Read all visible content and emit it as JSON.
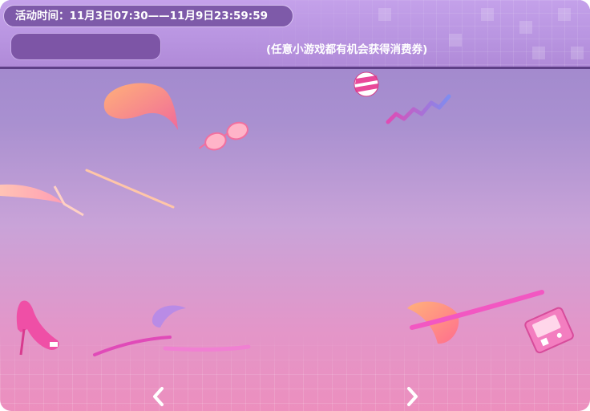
{
  "header": {
    "time_text": "活动时间：11月3日07:30——11月9日23:59:59",
    "hint_text": "(任意小游戏都有机会获得消费券)"
  },
  "nav": {
    "prev_icon": "chevron-left-icon",
    "next_icon": "chevron-right-icon"
  },
  "colors": {
    "header_bg": "#b894e0",
    "pill_bg": "#7e5aa9",
    "bg_top": "#9c83cc",
    "bg_bottom": "#ec8fbe"
  }
}
